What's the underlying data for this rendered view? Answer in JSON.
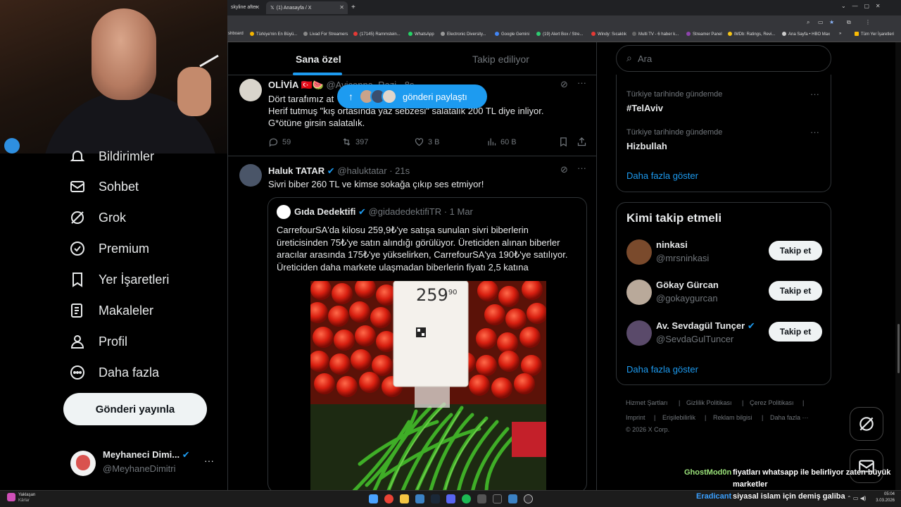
{
  "browser": {
    "tabs": [
      {
        "title": "skyline after"
      },
      {
        "title": "(1) Anasayfa / X"
      }
    ],
    "bookmarks": [
      "shboard",
      "Türkiye'nin En Büyü...",
      "Livad For Streamers",
      "(17145) Rammstein...",
      "WhatsApp",
      "Electronic Diversity...",
      "Google Gemini",
      "(19) Alert Box / Stre...",
      "Windy: Sıcaklık",
      "Multi TV - 6 haber k...",
      "Streamer Panel",
      "IMDb: Ratings, Revi...",
      "Ana Sayfa • HBO Max",
      "»",
      "Tüm Yer İşaretleri"
    ]
  },
  "sidebar": {
    "items": [
      {
        "label": "Bildirimler",
        "icon": "bell-icon"
      },
      {
        "label": "Sohbet",
        "icon": "mail-icon"
      },
      {
        "label": "Grok",
        "icon": "grok-icon"
      },
      {
        "label": "Premium",
        "icon": "premium-icon"
      },
      {
        "label": "Yer İşaretleri",
        "icon": "bookmark-icon"
      },
      {
        "label": "Makaleler",
        "icon": "article-icon"
      },
      {
        "label": "Profil",
        "icon": "profile-icon"
      },
      {
        "label": "Daha fazla",
        "icon": "more-circle-icon"
      }
    ],
    "post_button": "Gönderi yayınla",
    "account": {
      "name": "Meyhaneci Dimi...",
      "handle": "@MeyhaneDimitri",
      "more": "···"
    }
  },
  "feed": {
    "tabs": {
      "for_you": "Sana özel",
      "following": "Takip ediliyor"
    },
    "new_posts_pill": "gönderi paylaştı",
    "tweets": [
      {
        "name": "OLİVİA 🇹🇷🍉",
        "handle": "@Avicenna_Razi · 8s",
        "lines": [
          "Dört tarafımız at",
          "Herif tutmuş \"kış ortasında yaz sebzesi\" salatalık 200 TL diye inliyor.",
          "G*ötüne girsin salatalık."
        ],
        "replies": "59",
        "retweets": "397",
        "likes": "3 B",
        "views": "60 B"
      },
      {
        "name": "Haluk TATAR",
        "handle": "@haluktatar · 21s",
        "text": "Sivri biber 260 TL ve kimse sokağa çıkıp ses etmiyor!",
        "quote": {
          "name": "Gıda Dedektifi",
          "handle": "@gidadedektifiTR · 1 Mar",
          "lines": [
            "CarrefourSA'da kilosu 259,9₺'ye satışa sunulan sivri biberlerin",
            "üreticisinden 75₺'ye satın alındığı görülüyor. Üreticiden alınan biberler",
            "aracılar arasında 175₺'ye yükselirken, CarrefourSA'ya 190₺'ye satılıyor.",
            "Üreticiden daha markete ulaşmadan biberlerin fiyatı 2,5 katına"
          ],
          "price_tag": "259",
          "price_cents": "90"
        }
      }
    ]
  },
  "right": {
    "search_placeholder": "Ara",
    "trends": [
      {
        "meta": "Türkiye tarihinde gündemde",
        "name": "#TelAviv"
      },
      {
        "meta": "Türkiye tarihinde gündemde",
        "name": "Hizbullah"
      }
    ],
    "trends_more": "Daha fazla göster",
    "who_title": "Kimi takip etmeli",
    "who": [
      {
        "name": "ninkasi",
        "handle": "@mrsninkasi",
        "verified": false
      },
      {
        "name": "Gökay Gürcan",
        "handle": "@gokaygurcan",
        "verified": false
      },
      {
        "name": "Av. Sevdagül Tunçer",
        "handle": "@SevdaGulTuncer",
        "verified": true
      }
    ],
    "follow_label": "Takip et",
    "who_more": "Daha fazla göster",
    "footer": [
      "Hizmet Şartları",
      "|",
      "Gizlilik Politikası",
      "|",
      "Çerez Politikası",
      "|",
      "Imprint",
      "|",
      "Erişilebilirlik",
      "|",
      "Reklam bilgisi",
      "|",
      "Daha fazla ···",
      "© 2026 X Corp."
    ]
  },
  "chat": [
    {
      "user": "GhostMod0n",
      "color": "#9be37a",
      "msg": "fiyatları whatsapp ile belirliyor zaten büyük",
      "msg2": "marketler"
    },
    {
      "user": "Eradicant",
      "color": "#3aa0ff",
      "msg": "siyasal islam için demiş galiba"
    }
  ],
  "taskbar": {
    "weather": "Yaklaşan",
    "weather2": "Kârlar",
    "time": "05:04",
    "date": "3.03.2026"
  },
  "colors": {
    "accent": "#1d9bf0",
    "bg": "#000000",
    "border": "#2f3336",
    "muted": "#71767b"
  }
}
